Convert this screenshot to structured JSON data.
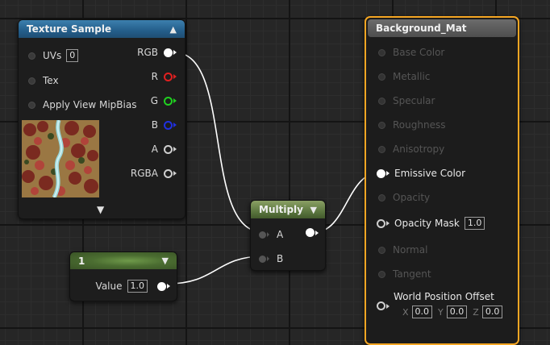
{
  "texture_sample": {
    "title": "Texture Sample",
    "inputs": [
      {
        "label": "UVs",
        "value": "0"
      },
      {
        "label": "Tex"
      },
      {
        "label": "Apply View MipBias"
      }
    ],
    "outputs": [
      {
        "label": "RGB",
        "color": "#ffffff"
      },
      {
        "label": "R",
        "color": "#e02020"
      },
      {
        "label": "G",
        "color": "#20d020"
      },
      {
        "label": "B",
        "color": "#2030e0"
      },
      {
        "label": "A",
        "color": "#cfcfcf"
      },
      {
        "label": "RGBA",
        "color": "#cfcfcf"
      }
    ]
  },
  "constant": {
    "title": "1",
    "value_label": "Value",
    "value": "1.0"
  },
  "multiply": {
    "title": "Multiply",
    "inputs": [
      {
        "label": "A"
      },
      {
        "label": "B"
      }
    ]
  },
  "material": {
    "title": "Background_Mat",
    "border_color": "#f5a623",
    "pins": [
      {
        "label": "Base Color",
        "enabled": false
      },
      {
        "label": "Metallic",
        "enabled": false
      },
      {
        "label": "Specular",
        "enabled": false
      },
      {
        "label": "Roughness",
        "enabled": false
      },
      {
        "label": "Anisotropy",
        "enabled": false
      },
      {
        "label": "Emissive Color",
        "enabled": true
      },
      {
        "label": "Opacity",
        "enabled": false
      },
      {
        "label": "Opacity Mask",
        "enabled": true,
        "value": "1.0"
      },
      {
        "label": "Normal",
        "enabled": false
      },
      {
        "label": "Tangent",
        "enabled": false
      },
      {
        "label": "World Position Offset",
        "enabled": true
      }
    ],
    "wpo": {
      "x_label": "X",
      "x": "0.0",
      "y_label": "Y",
      "y": "0.0",
      "z_label": "Z",
      "z": "0.0"
    }
  }
}
